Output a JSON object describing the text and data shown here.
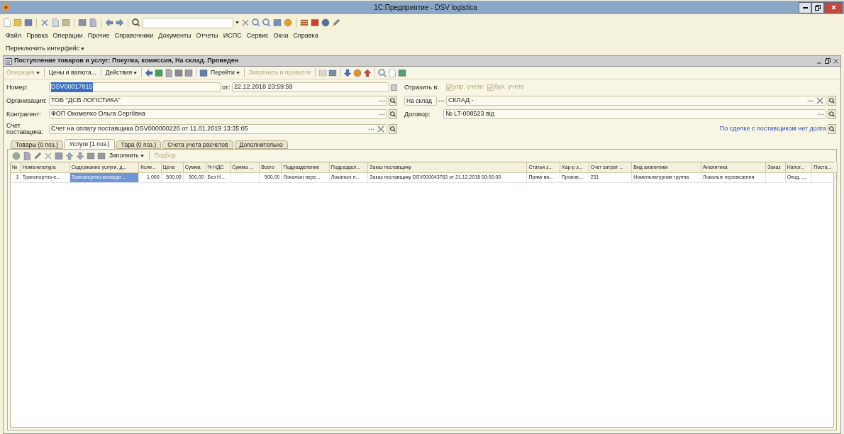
{
  "window": {
    "title": "1С:Предприятие - DSV logistica"
  },
  "menu": [
    "Файл",
    "Правка",
    "Операции",
    "Прочие",
    "Справочники",
    "Документы",
    "Отчеты",
    "ИСПС",
    "Сервис",
    "Окна",
    "Справка"
  ],
  "interface_switch": {
    "label": "Переключить интерфейс",
    "dropdown": true
  },
  "document": {
    "title": "Поступление товаров и услуг: Покупка, комиссия, На склад. Проведен",
    "toolbar": [
      {
        "label": "Операция",
        "disabled": true,
        "dropdown": true
      },
      {
        "label": "Цены и валюта...",
        "disabled": false,
        "dropdown": false
      },
      {
        "label": "Действия",
        "disabled": false,
        "dropdown": true
      },
      {
        "label": "Перейти",
        "disabled": false,
        "dropdown": true
      },
      {
        "label": "Заполнить и провести",
        "disabled": true,
        "dropdown": false
      }
    ],
    "number": {
      "label": "Номер:",
      "value": "DSV00017815",
      "highlighted": true
    },
    "date": {
      "label": "от:",
      "value": "22.12.2018 23:59:59"
    },
    "organization": {
      "label": "Организация:",
      "value": "ТОВ \"ДСВ ЛОГІСТИКА\""
    },
    "counterparty": {
      "label": "Контрагент:",
      "value": "ФОП Окомелко  Ольга  Сергіївна"
    },
    "supplier_invoice": {
      "label": "Счет поставщика:",
      "value": "Счет на оплату поставщика DSV000000220 от 11.01.2019 13:35:05"
    },
    "reflect": {
      "label": "Отразить в:",
      "options": [
        {
          "label": "упр. учете",
          "checked": true,
          "disabled": true
        },
        {
          "label": "бух. учете",
          "checked": true,
          "disabled": true
        }
      ]
    },
    "warehouse_kind": {
      "value": "На склад"
    },
    "warehouse": {
      "value": "СКЛАД -"
    },
    "contract": {
      "label": "Договор:",
      "value": "№ LT-008523 від"
    },
    "debt_link": "По сделке с поставщиком нет долга",
    "tabs": [
      {
        "label": "Товары (0 поз.)",
        "selected": false
      },
      {
        "label": "Услуги (1 поз.)",
        "selected": true
      },
      {
        "label": "Тара (0 поз.)",
        "selected": false
      },
      {
        "label": "Счета учета расчетов",
        "selected": false
      },
      {
        "label": "Дополнительно",
        "selected": false
      }
    ],
    "table_toolbar": [
      {
        "label": "Заполнить",
        "disabled": false,
        "dropdown": true
      },
      {
        "label": "Подбор",
        "disabled": true,
        "dropdown": false
      }
    ],
    "table": {
      "columns": [
        "№",
        "Номенклатура",
        "Содержание услуги, д...",
        "Коли...",
        "Цена",
        "Сумма",
        "% НДС",
        "Сумма ...",
        "Всего",
        "Подразделение",
        "Подраздел...",
        "Заказ поставщику",
        "Статья з...",
        "Хар-р з...",
        "Счет затрат ...",
        "Вид аналитики",
        "Аналитика",
        "Заказ",
        "Налог...",
        "Поста..."
      ],
      "rows": [
        {
          "cells": [
            {
              "text": "1",
              "selected": false
            },
            {
              "text": "Транспортно-е...",
              "selected": false
            },
            {
              "text": "Транспортно-експеди...",
              "selected": true
            },
            {
              "text": "1,000",
              "selected": false
            },
            {
              "text": "500,00",
              "selected": false
            },
            {
              "text": "500,00",
              "selected": false
            },
            {
              "text": "Без Н...",
              "selected": false
            },
            {
              "text": "",
              "selected": false
            },
            {
              "text": "500,00",
              "selected": false
            },
            {
              "text": "Локальні пере...",
              "selected": false
            },
            {
              "text": "Локальні п...",
              "selected": false
            },
            {
              "text": "Заказ поставщику DSV000043763 от 21.12.2018 00:00:00",
              "selected": false
            },
            {
              "text": "Прямі ви...",
              "selected": false
            },
            {
              "text": "Произв...",
              "selected": false
            },
            {
              "text": "231",
              "selected": false
            },
            {
              "text": "Номенклатурная группа",
              "selected": false
            },
            {
              "text": "Локальні перевезення",
              "selected": false
            },
            {
              "text": "",
              "selected": false
            },
            {
              "text": "Опод. ...",
              "selected": false
            },
            {
              "text": "",
              "selected": false
            }
          ]
        }
      ]
    }
  }
}
